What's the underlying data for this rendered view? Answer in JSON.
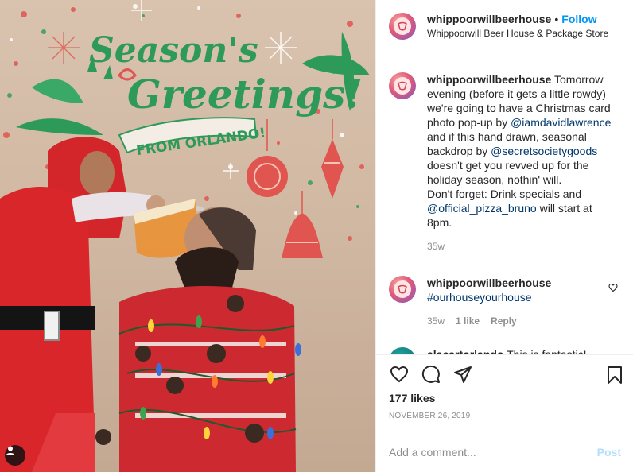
{
  "photo": {
    "artwork_text_line1": "Season's",
    "artwork_text_line2": "Greetings!",
    "artwork_banner": "FROM ORLANDO!"
  },
  "header": {
    "username": "whippoorwillbeerhouse",
    "separator": "•",
    "follow_label": "Follow",
    "location": "Whippoorwill Beer House & Package Store"
  },
  "caption": {
    "username": "whippoorwillbeerhouse",
    "text_1": "Tomorrow evening (before it gets a little rowdy) we're going to have a Christmas card photo pop-up by",
    "mention_1": "@iamdavidlawrence",
    "text_2": "and if this hand drawn, seasonal backdrop by",
    "mention_2": "@secretsocietygoods",
    "text_3": "doesn't get you revved up for the holiday season, nothin' will.",
    "text_4": "Don't forget: Drink specials and",
    "mention_3": "@official_pizza_bruno",
    "text_5": "will start at 8pm.",
    "time": "35w"
  },
  "comments": [
    {
      "username": "whippoorwillbeerhouse",
      "hashtag": "#ourhouseyourhouse",
      "time": "35w",
      "likes": "1 like",
      "reply_label": "Reply"
    },
    {
      "username": "alacartorlando",
      "text": "This is fantastic!"
    }
  ],
  "stats": {
    "likes": "177 likes",
    "date": "NOVEMBER 26, 2019"
  },
  "composer": {
    "placeholder": "Add a comment...",
    "post_label": "Post"
  },
  "colors": {
    "link": "#00376b",
    "follow": "#0095f6",
    "post_disabled": "#b2dffc",
    "artwork_green": "#2e9a5a",
    "artwork_red": "#e0554f"
  },
  "icons": [
    "heart-icon",
    "comment-icon",
    "share-icon",
    "bookmark-icon",
    "user-tag-icon"
  ]
}
